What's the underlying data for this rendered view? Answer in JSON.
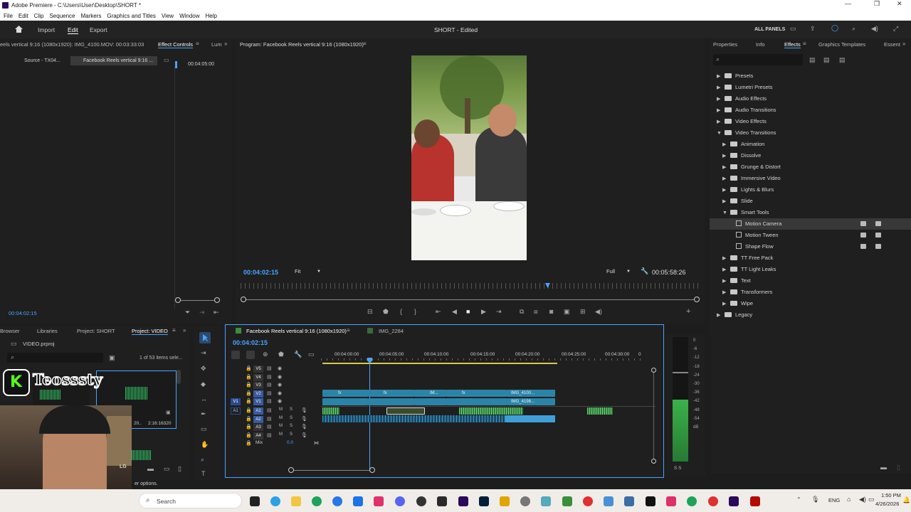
{
  "titlebar": {
    "title": "Adobe Premiere - C:\\Users\\User\\Desktop\\SHORT *"
  },
  "menu": [
    "File",
    "Edit",
    "Clip",
    "Sequence",
    "Markers",
    "Graphics and Titles",
    "View",
    "Window",
    "Help"
  ],
  "header": {
    "import": "Import",
    "edit": "Edit",
    "export": "Export",
    "project_title": "SHORT - Edited",
    "all_panels": "ALL PANELS"
  },
  "source": {
    "title": "eels vertical 9:16 (1080x1920): IMG_4100.MOV: 00:03:33:03",
    "tab_effect_controls": "Effect Controls",
    "tab_lum": "Lum",
    "source_tab": "Source - TX04...",
    "seq_tab": "Facebook Reels vertical 9:16 ...",
    "time_marker": "00:04:05:00",
    "timecode": "00:04:02:15"
  },
  "program": {
    "title": "Program: Facebook Reels vertical 9:16 (1080x1920)",
    "timecode": "00:04:02:15",
    "fit": "Fit",
    "quality": "Full",
    "duration": "00:05:58:26"
  },
  "effects": {
    "tabs": [
      "Properties",
      "Info",
      "Effects",
      "Graphics Templates",
      "Essent"
    ],
    "tree": [
      {
        "label": "Presets",
        "level": 0,
        "type": "folder",
        "open": false
      },
      {
        "label": "Lumetri Presets",
        "level": 0,
        "type": "folder",
        "open": false
      },
      {
        "label": "Audio Effects",
        "level": 0,
        "type": "folder",
        "open": false
      },
      {
        "label": "Audio Transitions",
        "level": 0,
        "type": "folder",
        "open": false
      },
      {
        "label": "Video Effects",
        "level": 0,
        "type": "folder",
        "open": false
      },
      {
        "label": "Video Transitions",
        "level": 0,
        "type": "folder",
        "open": true
      },
      {
        "label": "Animation",
        "level": 1,
        "type": "folder",
        "open": false
      },
      {
        "label": "Dissolve",
        "level": 1,
        "type": "folder",
        "open": false
      },
      {
        "label": "Grunge & Distort",
        "level": 1,
        "type": "folder",
        "open": false
      },
      {
        "label": "Immersive Video",
        "level": 1,
        "type": "folder",
        "open": false
      },
      {
        "label": "Lights & Blurs",
        "level": 1,
        "type": "folder",
        "open": false
      },
      {
        "label": "Slide",
        "level": 1,
        "type": "folder",
        "open": false
      },
      {
        "label": "Smart Tools",
        "level": 1,
        "type": "folder",
        "open": true
      },
      {
        "label": "Motion Camera",
        "level": 2,
        "type": "effect",
        "selected": true
      },
      {
        "label": "Motion Tween",
        "level": 2,
        "type": "effect"
      },
      {
        "label": "Shape Flow",
        "level": 2,
        "type": "effect"
      },
      {
        "label": "TT Free Pack",
        "level": 1,
        "type": "folder",
        "open": false
      },
      {
        "label": "TT Light Leaks",
        "level": 1,
        "type": "folder",
        "open": false
      },
      {
        "label": "Text",
        "level": 1,
        "type": "folder",
        "open": false
      },
      {
        "label": "Transformers",
        "level": 1,
        "type": "folder",
        "open": false
      },
      {
        "label": "Wipe",
        "level": 1,
        "type": "folder",
        "open": false
      },
      {
        "label": "Legacy",
        "level": 0,
        "type": "folder",
        "open": false
      }
    ]
  },
  "project": {
    "tabs": [
      "Browser",
      "Libraries",
      "Project: SHORT",
      "Project: VIDEO"
    ],
    "file": "VIDEO.prproj",
    "count": "1 of 53 items sele...",
    "item_a": "20..",
    "item_b": "2:16:16320"
  },
  "webcam": {
    "overlay_text": "Teosssty",
    "logo_letter": "K",
    "tv_brand": "LG"
  },
  "timeline": {
    "tab1": "Facebook Reels vertical 9:16 (1080x1920)",
    "tab2": "IMG_2284",
    "timecode": "00:04:02:15",
    "ruler": [
      "00:04:00:00",
      "00:04:05:00",
      "00:04:10:00",
      "00:04:15:00",
      "00:04:20:00",
      "00:04:25:00",
      "00:04:30:00",
      "0"
    ],
    "video_tracks": [
      "V5",
      "V4",
      "V3",
      "V2",
      "V1"
    ],
    "audio_tracks": [
      "A1",
      "A2",
      "A3",
      "A4"
    ],
    "mix_label": "Mix",
    "mix_value": "0.0",
    "v1_patch": "V1",
    "a1_patch": "A1",
    "clip_labels": {
      "c1": "fx",
      "c2": "fx",
      "c3": "IM...",
      "c4": "fx",
      "c5": "IMG_4100...",
      "c6": "IMG_4198...",
      "c7": "fx"
    }
  },
  "meter": {
    "scale": [
      "0",
      "-6",
      "-12",
      "-18",
      "-24",
      "-30",
      "-36",
      "-42",
      "-48",
      "-54",
      "dB"
    ],
    "solo": "S  S"
  },
  "status": {
    "text": "er options."
  },
  "taskbar": {
    "search": "Search",
    "lang": "ENG",
    "time": "1:50 PM",
    "date": "4/26/2026"
  }
}
